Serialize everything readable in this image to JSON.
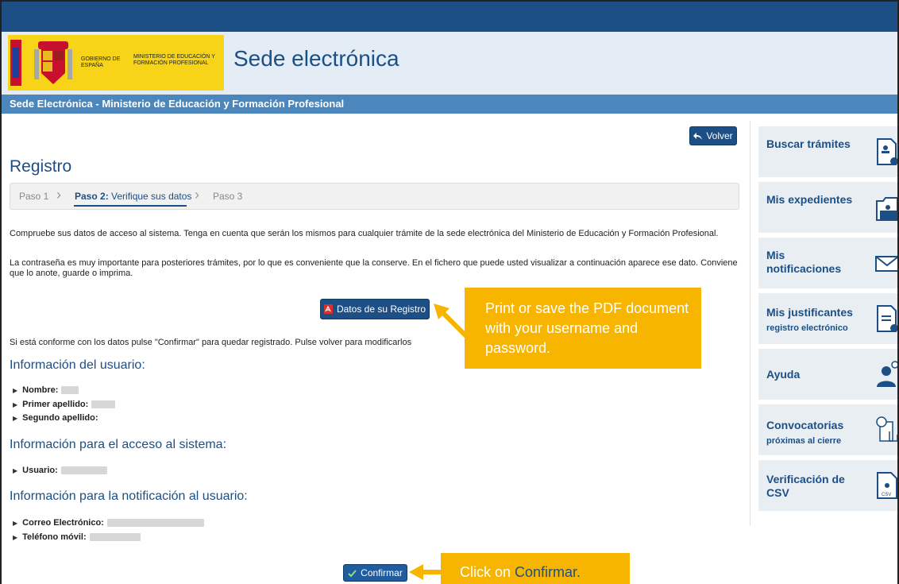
{
  "header": {
    "logo_left": "GOBIERNO DE ESPAÑA",
    "logo_right": "MINISTERIO DE EDUCACIÓN Y FORMACIÓN PROFESIONAL",
    "site_title": "Sede electrónica",
    "subbar_title": "Sede Electrónica - Ministerio de Educación y Formación Profesional"
  },
  "main": {
    "volver_label": "Volver",
    "heading": "Registro",
    "steps": {
      "step1": "Paso 1",
      "step2_prefix": "Paso 2:",
      "step2_text": " Verifique sus datos",
      "step3": "Paso 3"
    },
    "para1": "Compruebe sus datos de acceso al sistema. Tenga en cuenta que serán los mismos para cualquier trámite de la sede electrónica del Ministerio de Educación y Formación Profesional.",
    "para2": "La contraseña es muy importante para posteriores trámites, por lo que es conveniente que la conserve. En el fichero que puede usted visualizar a continuación aparece ese dato. Conviene que lo anote, guarde o imprima.",
    "datos_button": "Datos de su Registro",
    "para3": "Si está conforme con los datos pulse \"Confirmar\" para quedar registrado. Pulse volver para modificarlos",
    "section_user": "Información del usuario:",
    "nombre_label": "Nombre:",
    "primer_apellido_label": "Primer apellido:",
    "segundo_apellido_label": "Segundo apellido:",
    "section_access": "Información para el acceso al sistema:",
    "usuario_label": "Usuario:",
    "section_notif": "Información para la notificación al usuario:",
    "correo_label": "Correo Electrónico:",
    "telefono_label": "Teléfono móvil:",
    "confirm_button": "Confirmar"
  },
  "callouts": {
    "pdf": "Print or save the PDF document with your username and password.",
    "confirm_prefix": "Click on ",
    "confirm_word": "Confirmar."
  },
  "sidebar": {
    "items": [
      {
        "label": "Buscar trámites",
        "sub": "",
        "icon": "search-document-icon"
      },
      {
        "label": "Mis expedientes",
        "sub": "",
        "icon": "folder-search-icon"
      },
      {
        "label": "Mis notificaciones",
        "sub": "",
        "icon": "envelope-icon"
      },
      {
        "label": "Mis justificantes",
        "sub": "registro electrónico",
        "icon": "document-download-icon"
      },
      {
        "label": "Ayuda",
        "sub": "",
        "icon": "user-help-icon"
      },
      {
        "label": "Convocatorias",
        "sub": "próximas al cierre",
        "icon": "calendar-touch-icon"
      },
      {
        "label": "Verificación de CSV",
        "sub": "",
        "icon": "csv-document-icon"
      }
    ]
  },
  "colors": {
    "brand": "#1c4f86",
    "callout": "#f7b500",
    "logo_yellow": "#f7d417"
  }
}
